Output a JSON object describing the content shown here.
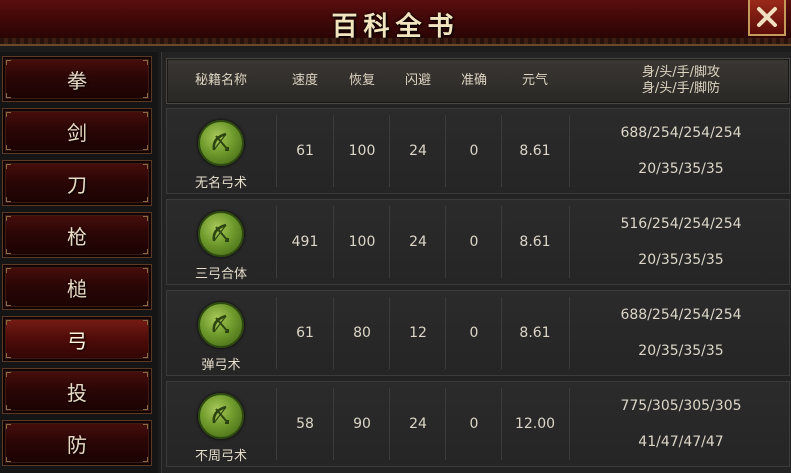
{
  "window": {
    "title": "百科全书",
    "close_icon": "close-x-icon"
  },
  "sidebar": {
    "items": [
      {
        "label": "拳",
        "active": false
      },
      {
        "label": "剑",
        "active": false
      },
      {
        "label": "刀",
        "active": false
      },
      {
        "label": "枪",
        "active": false
      },
      {
        "label": "槌",
        "active": false
      },
      {
        "label": "弓",
        "active": true
      },
      {
        "label": "投",
        "active": false
      },
      {
        "label": "防",
        "active": false
      }
    ]
  },
  "table": {
    "headers": {
      "name": "秘籍名称",
      "speed": "速度",
      "recover": "恢复",
      "dodge": "闪避",
      "accuracy": "准确",
      "qi": "元气",
      "attr_line1": "身/头/手/脚攻",
      "attr_line2": "身/头/手/脚防"
    },
    "rows": [
      {
        "name": "无名弓术",
        "speed": "61",
        "recover": "100",
        "dodge": "24",
        "accuracy": "0",
        "qi": "8.61",
        "attack": "688/254/254/254",
        "defense": "20/35/35/35"
      },
      {
        "name": "三弓合体",
        "speed": "491",
        "recover": "100",
        "dodge": "24",
        "accuracy": "0",
        "qi": "8.61",
        "attack": "516/254/254/254",
        "defense": "20/35/35/35"
      },
      {
        "name": "弹弓术",
        "speed": "61",
        "recover": "80",
        "dodge": "12",
        "accuracy": "0",
        "qi": "8.61",
        "attack": "688/254/254/254",
        "defense": "20/35/35/35"
      },
      {
        "name": "不周弓术",
        "speed": "58",
        "recover": "90",
        "dodge": "24",
        "accuracy": "0",
        "qi": "12.00",
        "attack": "775/305/305/305",
        "defense": "41/47/47/47"
      }
    ]
  },
  "colors": {
    "title_bg": "#3b0707",
    "book_icon": "#6f9a2c",
    "panel_bg": "#232323"
  }
}
